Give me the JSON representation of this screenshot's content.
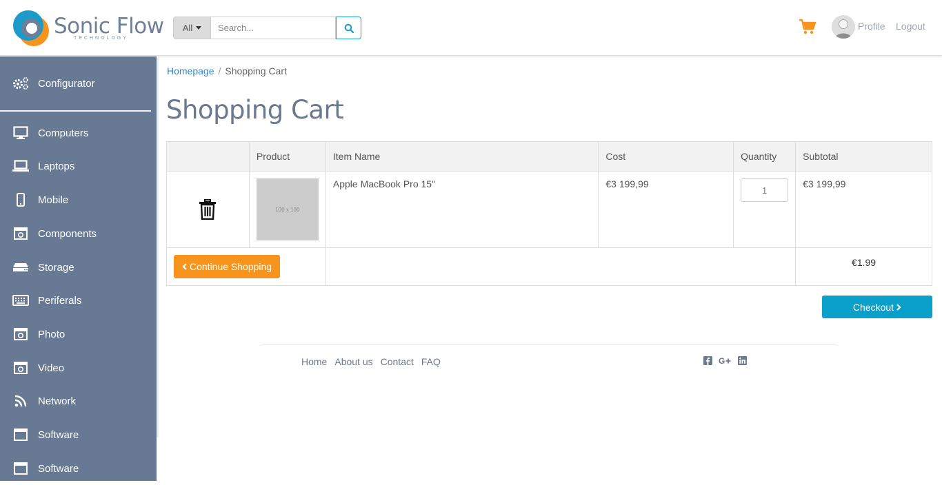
{
  "brand": {
    "name": "Sonic Flow",
    "tagline": "TECHNOLOGY"
  },
  "search": {
    "category": "All",
    "placeholder": "Search..."
  },
  "header": {
    "profile": "Profile",
    "logout": "Logout"
  },
  "sidebar": {
    "configurator": "Configurator",
    "items": [
      {
        "label": "Computers",
        "icon": "monitor-icon"
      },
      {
        "label": "Laptops",
        "icon": "laptop-icon"
      },
      {
        "label": "Mobile",
        "icon": "mobile-icon"
      },
      {
        "label": "Components",
        "icon": "component-icon"
      },
      {
        "label": "Storage",
        "icon": "hdd-icon"
      },
      {
        "label": "Periferals",
        "icon": "keyboard-icon"
      },
      {
        "label": "Photo",
        "icon": "camera-icon"
      },
      {
        "label": "Video",
        "icon": "video-icon"
      },
      {
        "label": "Network",
        "icon": "rss-icon"
      },
      {
        "label": "Software",
        "icon": "window-icon"
      },
      {
        "label": "Software",
        "icon": "window-icon"
      }
    ]
  },
  "breadcrumb": {
    "home": "Homepage",
    "current": "Shopping Cart"
  },
  "page": {
    "title": "Shopping Cart"
  },
  "cart": {
    "columns": [
      "",
      "Product",
      "Item Name",
      "Cost",
      "Quantity",
      "Subtotal"
    ],
    "items": [
      {
        "thumb": "100 x 100",
        "name": "Apple MacBook Pro 15\"",
        "cost": "€3 199,99",
        "quantity": "1",
        "subtotal": "€3 199,99"
      }
    ],
    "total": "€1.99",
    "continue_label": "Continue Shopping",
    "checkout_label": "Checkout"
  },
  "footer": {
    "links": [
      "Home",
      "About us",
      "Contact",
      "FAQ"
    ]
  },
  "colors": {
    "accent_orange": "#f7941d",
    "accent_blue": "#0ba0c9",
    "sidebar": "#687a93"
  }
}
